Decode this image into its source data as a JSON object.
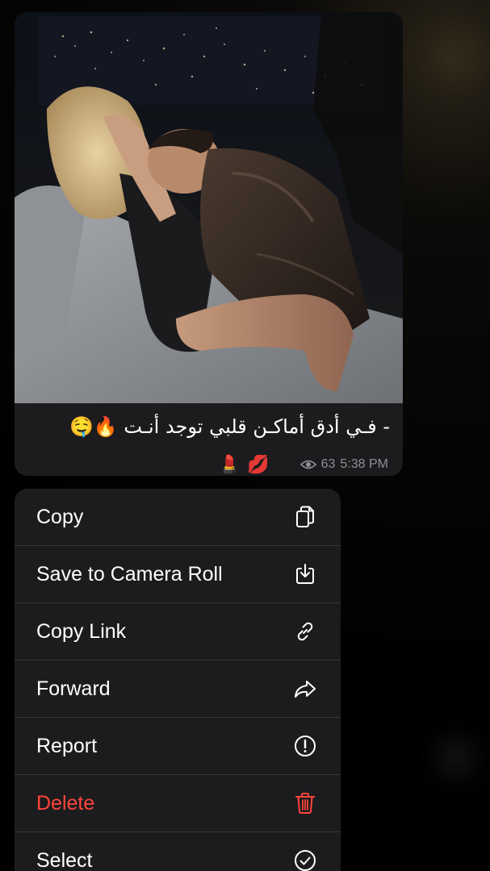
{
  "message": {
    "caption": "- فـي أدق أماكـن قلبي توجد أنـت 🔥🤤",
    "reaction_emoji": "💄💋",
    "views": "63",
    "time": "5:38 PM"
  },
  "menu": {
    "items": [
      {
        "label": "Copy",
        "icon": "copy-icon"
      },
      {
        "label": "Save to Camera Roll",
        "icon": "save-download-icon"
      },
      {
        "label": "Copy Link",
        "icon": "link-icon"
      },
      {
        "label": "Forward",
        "icon": "forward-arrow-icon"
      },
      {
        "label": "Report",
        "icon": "exclamation-circle-icon"
      },
      {
        "label": "Delete",
        "icon": "trash-icon"
      },
      {
        "label": "Select",
        "icon": "checkmark-circle-icon"
      }
    ]
  },
  "colors": {
    "background": "#000000",
    "bubble": "#1c1c1e",
    "menu": "#1c1c1e",
    "separator": "#38383a",
    "text": "#ffffff",
    "meta": "#8e8e93",
    "danger": "#ff453a"
  }
}
